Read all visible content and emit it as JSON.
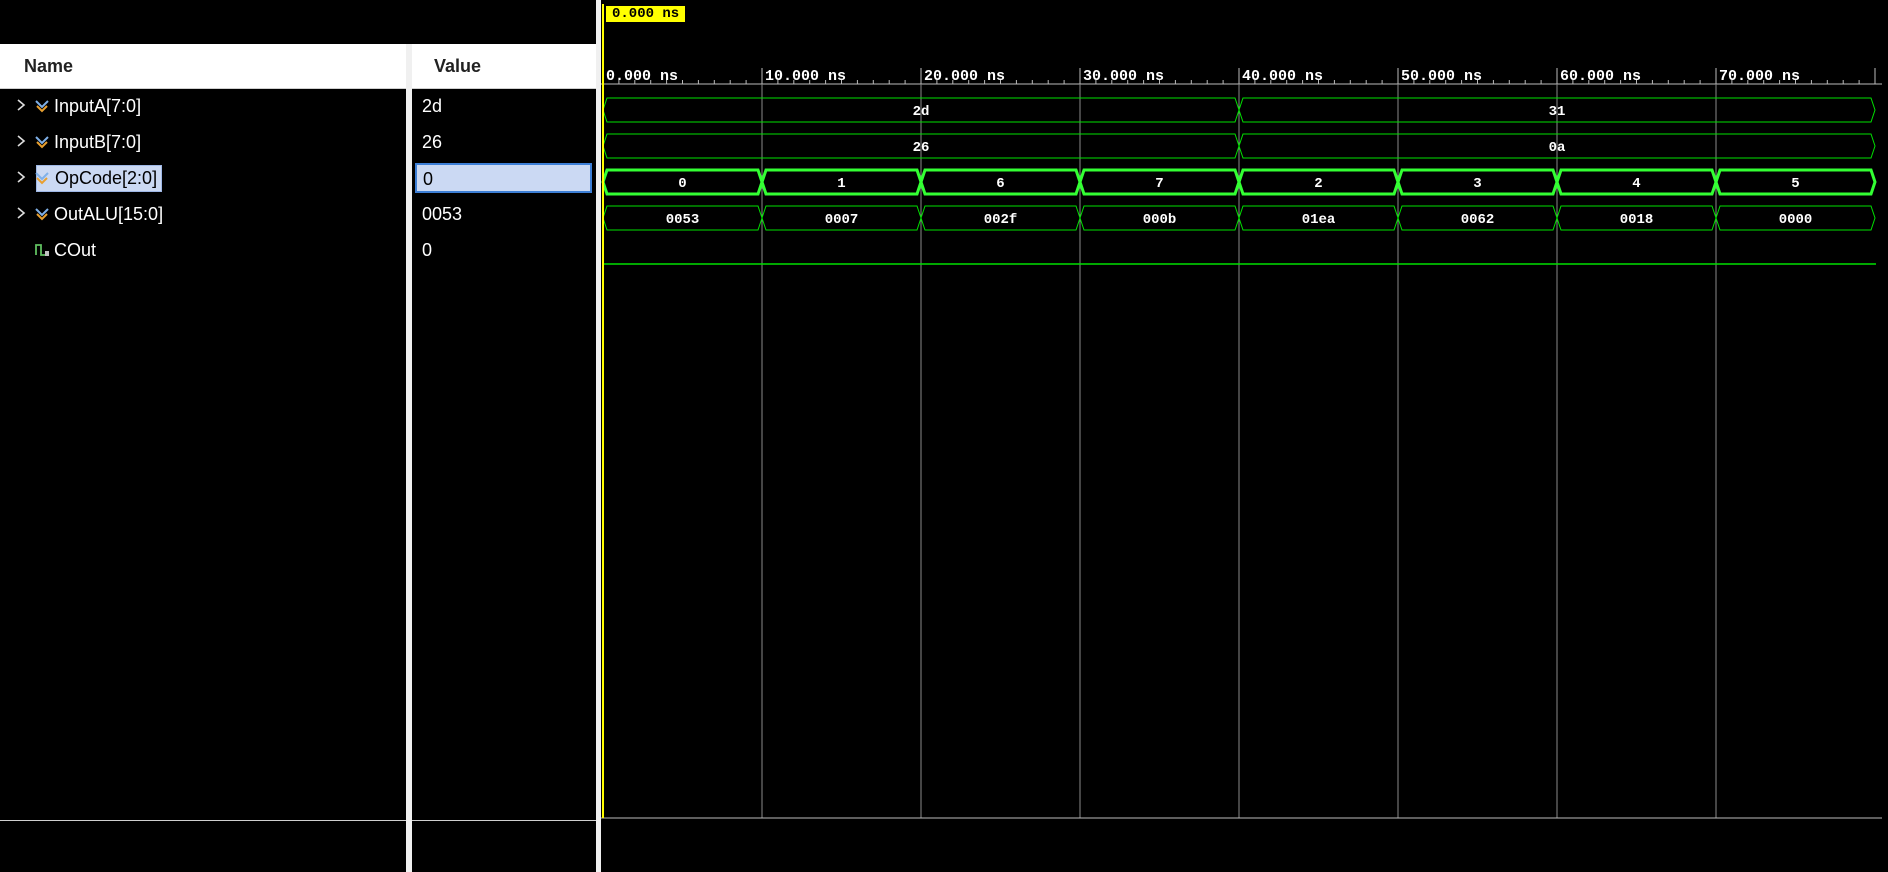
{
  "panels": {
    "name_header": "Name",
    "value_header": "Value"
  },
  "signals": [
    {
      "name": "InputA[7:0]",
      "value": "2d",
      "icon": "bus-signal-icon",
      "expandable": true,
      "selected": false
    },
    {
      "name": "InputB[7:0]",
      "value": "26",
      "icon": "bus-signal-icon",
      "expandable": true,
      "selected": false
    },
    {
      "name": "OpCode[2:0]",
      "value": "0",
      "icon": "bus-signal-icon",
      "expandable": true,
      "selected": true
    },
    {
      "name": "OutALU[15:0]",
      "value": "0053",
      "icon": "bus-signal-icon",
      "expandable": true,
      "selected": false
    },
    {
      "name": "COut",
      "value": "0",
      "icon": "bit-signal-icon",
      "expandable": false,
      "selected": false
    }
  ],
  "timeline": {
    "cursor_label": "0.000 ns",
    "ticks": [
      "0.000 ns",
      "10.000 ns",
      "20.000 ns",
      "30.000 ns",
      "40.000 ns",
      "50.000 ns",
      "60.000 ns",
      "70.000 ns"
    ]
  },
  "waveforms": {
    "InputA": [
      {
        "start": 0,
        "end": 40,
        "label": "2d"
      },
      {
        "start": 40,
        "end": 80,
        "label": "31"
      }
    ],
    "InputB": [
      {
        "start": 0,
        "end": 40,
        "label": "26"
      },
      {
        "start": 40,
        "end": 80,
        "label": "0a"
      }
    ],
    "OpCode": [
      {
        "start": 0,
        "end": 10,
        "label": "0"
      },
      {
        "start": 10,
        "end": 20,
        "label": "1"
      },
      {
        "start": 20,
        "end": 30,
        "label": "6"
      },
      {
        "start": 30,
        "end": 40,
        "label": "7"
      },
      {
        "start": 40,
        "end": 50,
        "label": "2"
      },
      {
        "start": 50,
        "end": 60,
        "label": "3"
      },
      {
        "start": 60,
        "end": 70,
        "label": "4"
      },
      {
        "start": 70,
        "end": 80,
        "label": "5"
      }
    ],
    "OutALU": [
      {
        "start": 0,
        "end": 10,
        "label": "0053"
      },
      {
        "start": 10,
        "end": 20,
        "label": "0007"
      },
      {
        "start": 20,
        "end": 30,
        "label": "002f"
      },
      {
        "start": 30,
        "end": 40,
        "label": "000b"
      },
      {
        "start": 40,
        "end": 50,
        "label": "01ea"
      },
      {
        "start": 50,
        "end": 60,
        "label": "0062"
      },
      {
        "start": 60,
        "end": 70,
        "label": "0018"
      },
      {
        "start": 70,
        "end": 80,
        "label": "0000"
      }
    ],
    "COut": {
      "level": 0
    }
  },
  "colors": {
    "wave": "#00e000",
    "wave_highlight": "#33ff33",
    "gridline": "#8a8a8a",
    "cursor": "#ffff00",
    "selection": "#cbd9f3"
  }
}
